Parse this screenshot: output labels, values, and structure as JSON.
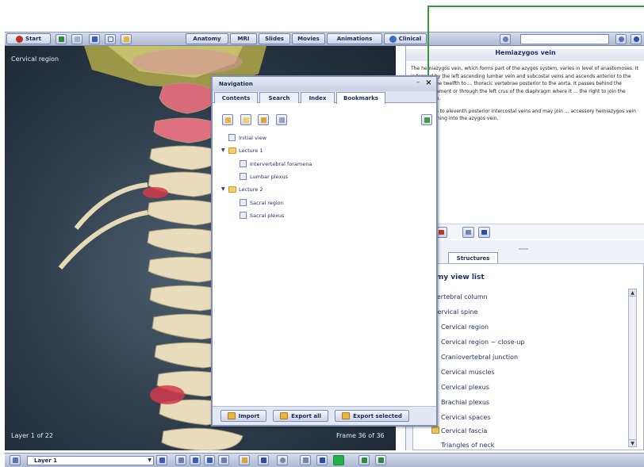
{
  "toolbar": {
    "start_label": "Start",
    "tabs": [
      "Anatomy",
      "MRI",
      "Slides",
      "Movies",
      "Animations",
      "Clinical"
    ],
    "search_placeholder": ""
  },
  "viewport": {
    "region_label": "Cervical region",
    "layer_status": "Layer 1 of 22",
    "frame_status": "Frame 36 of 36"
  },
  "info": {
    "title": "Hemiazygos vein",
    "para1": "The hemiazygos vein, which forms part of the azygos system, varies in level of anastomoses. It is formed by the left ascending lumbar vein and subcostal veins and ascends anterior to the bodies of the twelfth to ... thoracic vertebrae posterior to the aorta. It passes behind the arcuate ligament or through the left crus of the diaphragm where it ... the right to join the azygos vein.",
    "para2": "... the ninth to eleventh posterior intercostal veins and may join ... accessory hemiazygos vein before draining into the azygos vein."
  },
  "navigation": {
    "title": "Navigation",
    "tabs": [
      "Contents",
      "Search",
      "Index",
      "Bookmarks"
    ],
    "active_tab": "Bookmarks",
    "tree": {
      "initial": "Initial view",
      "lecture1": "Lecture 1",
      "l1_items": [
        "Intervertebral foramena",
        "Lumbar plexus"
      ],
      "lecture2": "Lecture 2",
      "l2_items": [
        "Sacral region",
        "Sacral plexus"
      ]
    },
    "footer": {
      "import": "Import",
      "export_all": "Export all",
      "export_selected": "Export selected"
    }
  },
  "structures": {
    "tab_label": "Structures",
    "header": "Anatomy view list",
    "items": [
      "Vertebral column",
      "Cervical spine",
      "Cervical region",
      "Cervical region ~ close-up",
      "Craniovertebral junction",
      "Cervical muscles",
      "Cervical plexus",
      "Brachial plexus",
      "Cervical spaces",
      "Cervical fascia",
      "Triangles of neck"
    ]
  },
  "bottom": {
    "layer_label": "Layer 1"
  },
  "colors": {
    "accent": "#1f2e5c",
    "toolbar": "#c4cce0",
    "callout": "#3a9a3a"
  }
}
